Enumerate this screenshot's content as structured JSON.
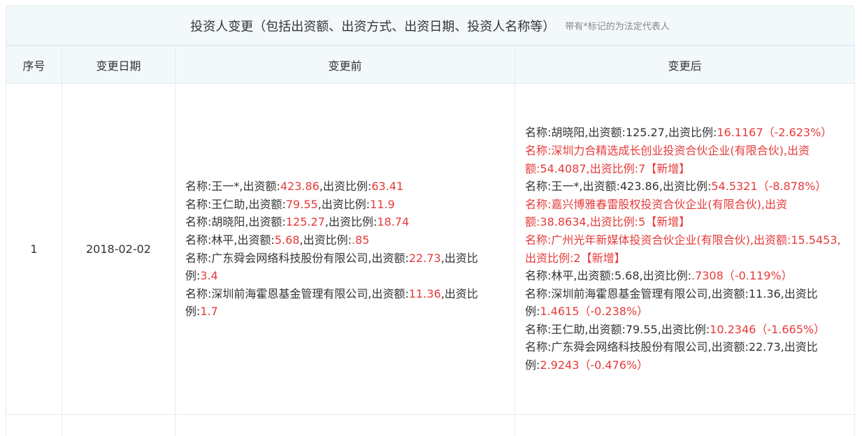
{
  "header": {
    "title": "投资人变更（包括出资额、出资方式、出资日期、投资人名称等）",
    "note": "带有*标记的为法定代表人"
  },
  "columns": [
    "序号",
    "变更日期",
    "变更前",
    "变更后"
  ],
  "rows": [
    {
      "index": "1",
      "date": "2018-02-02",
      "before": [
        {
          "p1": "名称:王一*,出资额:",
          "r1": "423.86",
          "p2": ",出资比例:",
          "r2": "63.41"
        },
        {
          "p1": "名称:王仁助,出资额:",
          "r1": "79.55",
          "p2": ",出资比例:",
          "r2": "11.9"
        },
        {
          "p1": "名称:胡晓阳,出资额:",
          "r1": "125.27",
          "p2": ",出资比例:",
          "r2": "18.74"
        },
        {
          "p1": "名称:林平,出资额:",
          "r1": "5.68",
          "p2": ",出资比例:",
          "r2": ".85"
        },
        {
          "p1": "名称:广东舜会网络科技股份有限公司,出资额:",
          "r1": "22.73",
          "p2": ",出资比例:",
          "r2": "3.4"
        },
        {
          "p1": "名称:深圳前海霍恩基金管理有限公司,出资额:",
          "r1": "11.36",
          "p2": ",出资比例:",
          "r2": "1.7"
        }
      ],
      "after": [
        {
          "new": false,
          "text": "名称:胡晓阳,出资额:125.27,出资比例:",
          "ratio": "16.1167（-2.623%）"
        },
        {
          "new": true,
          "text": "名称:深圳力合精选成长创业投资合伙企业(有限合伙),出资额:54.4087,出资比例:7【新增】"
        },
        {
          "new": false,
          "text": "名称:王一*,出资额:423.86,出资比例:",
          "ratio": "54.5321（-8.878%）"
        },
        {
          "new": true,
          "text": "名称:嘉兴博雅春雷股权投资合伙企业(有限合伙),出资额:38.8634,出资比例:5【新增】"
        },
        {
          "new": true,
          "text": "名称:广州光年新媒体投资合伙企业(有限合伙),出资额:15.5453,出资比例:2【新增】"
        },
        {
          "new": false,
          "text": "名称:林平,出资额:5.68,出资比例:",
          "ratio": ".7308（-0.119%）"
        },
        {
          "new": false,
          "text": "名称:深圳前海霍恩基金管理有限公司,出资额:11.36,出资比例:",
          "ratio": "1.4615（-0.238%）"
        },
        {
          "new": false,
          "text": "名称:王仁助,出资额:79.55,出资比例:",
          "ratio": "10.2346（-1.665%）"
        },
        {
          "new": false,
          "text": "名称:广东舜会网络科技股份有限公司,出资额:22.73,出资比例:",
          "ratio": "2.9243（-0.476%）"
        }
      ]
    }
  ],
  "colors": {
    "highlight": "#e63a3a",
    "header_bg": "#f3f8fb",
    "border": "#e4ecf1"
  }
}
